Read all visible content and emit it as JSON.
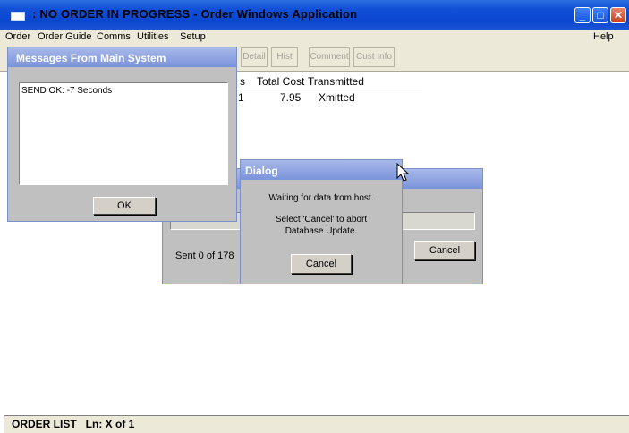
{
  "window": {
    "title": ": NO ORDER IN PROGRESS - Order Windows Application"
  },
  "menu": {
    "items": [
      "Order",
      "Order Guide",
      "Comms",
      "Utilities",
      "Setup"
    ],
    "help": "Help"
  },
  "toolbar": {
    "buttons": [
      "Detail",
      "Hist",
      "Comment",
      "Cust Info"
    ]
  },
  "order_list": {
    "columns": [
      "s",
      "Total Cost",
      "Transmitted"
    ],
    "rows": [
      {
        "id_fragment": "1",
        "total_cost": "7.95",
        "transmitted": "Xmitted"
      }
    ]
  },
  "status_bar": {
    "text": "ORDER LIST   Ln: X of 1"
  },
  "messages_dialog": {
    "title": "Messages From Main System",
    "message": "SEND OK: -7 Seconds",
    "ok_label": "OK"
  },
  "progress_dialog": {
    "sent_text": "Sent 0 of 178",
    "cancel_label": "Cancel"
  },
  "wait_dialog": {
    "title": "Dialog",
    "line1": "Waiting for data from host.",
    "line2": "Select 'Cancel' to abort",
    "line3": "Database Update.",
    "cancel_label": "Cancel"
  },
  "colors": {
    "title_bar": "#0a46d0",
    "dialog_face": "#c0c0c0",
    "dialog_title": "#8aa2e0",
    "menu_face": "#ece9d8"
  }
}
